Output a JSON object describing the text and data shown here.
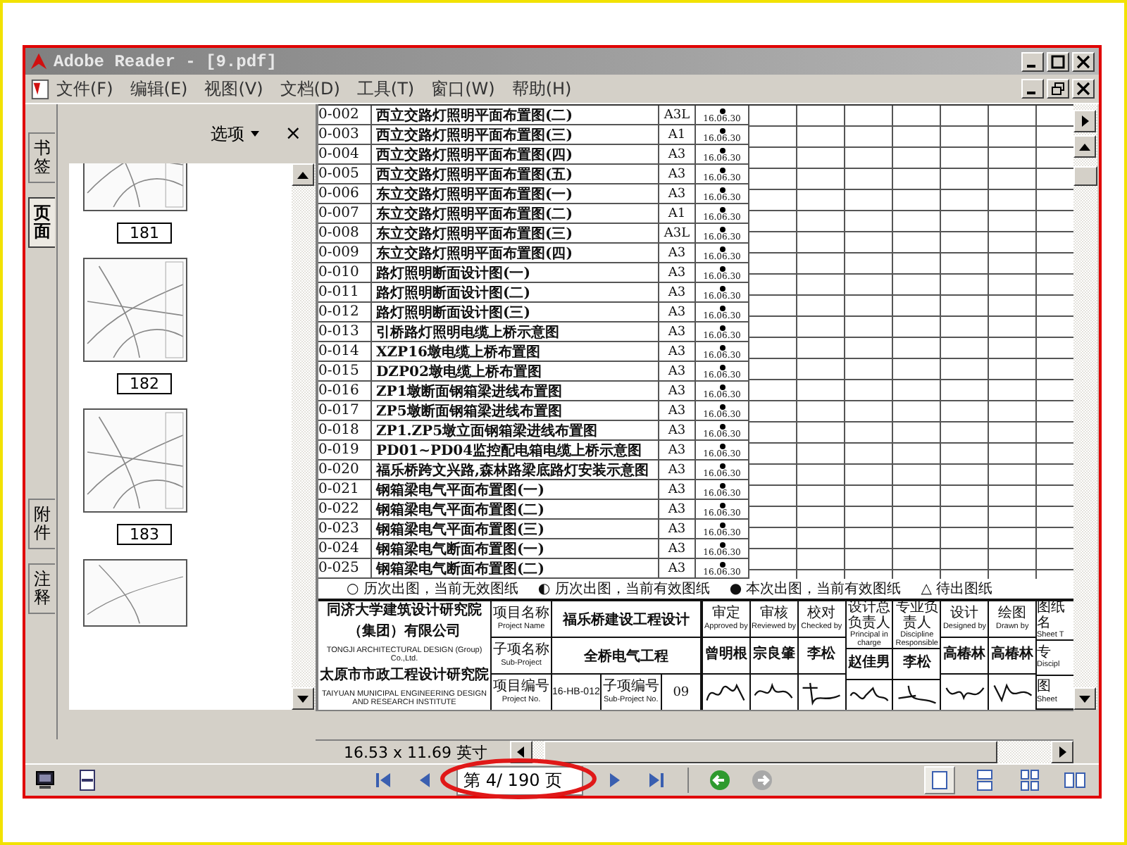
{
  "window": {
    "title": "Adobe Reader - [9.pdf]"
  },
  "menu": [
    "文件(F)",
    "编辑(E)",
    "视图(V)",
    "文档(D)",
    "工具(T)",
    "窗口(W)",
    "帮助(H)"
  ],
  "side_tabs": [
    {
      "label": "书签",
      "selected": false
    },
    {
      "label": "页面",
      "selected": true
    },
    {
      "label": "附件",
      "selected": false
    },
    {
      "label": "注释",
      "selected": false
    }
  ],
  "panel": {
    "options": "选项",
    "close": "×",
    "thumbnails": [
      "181",
      "182",
      "183"
    ]
  },
  "document": {
    "rows": [
      {
        "code": "0-002",
        "title": "西立交路灯照明平面布置图(二)",
        "size": "A3L",
        "date": "16.06.30"
      },
      {
        "code": "0-003",
        "title": "西立交路灯照明平面布置图(三)",
        "size": "A1",
        "date": "16.06.30"
      },
      {
        "code": "0-004",
        "title": "西立交路灯照明平面布置图(四)",
        "size": "A3",
        "date": "16.06.30"
      },
      {
        "code": "0-005",
        "title": "西立交路灯照明平面布置图(五)",
        "size": "A3",
        "date": "16.06.30"
      },
      {
        "code": "0-006",
        "title": "东立交路灯照明平面布置图(一)",
        "size": "A3",
        "date": "16.06.30"
      },
      {
        "code": "0-007",
        "title": "东立交路灯照明平面布置图(二)",
        "size": "A1",
        "date": "16.06.30"
      },
      {
        "code": "0-008",
        "title": "东立交路灯照明平面布置图(三)",
        "size": "A3L",
        "date": "16.06.30"
      },
      {
        "code": "0-009",
        "title": "东立交路灯照明平面布置图(四)",
        "size": "A3",
        "date": "16.06.30"
      },
      {
        "code": "0-010",
        "title": "路灯照明断面设计图(一)",
        "size": "A3",
        "date": "16.06.30"
      },
      {
        "code": "0-011",
        "title": "路灯照明断面设计图(二)",
        "size": "A3",
        "date": "16.06.30"
      },
      {
        "code": "0-012",
        "title": "路灯照明断面设计图(三)",
        "size": "A3",
        "date": "16.06.30"
      },
      {
        "code": "0-013",
        "title": "引桥路灯照明电缆上桥示意图",
        "size": "A3",
        "date": "16.06.30"
      },
      {
        "code": "0-014",
        "title": "XZP16墩电缆上桥布置图",
        "size": "A3",
        "date": "16.06.30"
      },
      {
        "code": "0-015",
        "title": "DZP02墩电缆上桥布置图",
        "size": "A3",
        "date": "16.06.30"
      },
      {
        "code": "0-016",
        "title": "ZP1墩断面钢箱梁进线布置图",
        "size": "A3",
        "date": "16.06.30"
      },
      {
        "code": "0-017",
        "title": "ZP5墩断面钢箱梁进线布置图",
        "size": "A3",
        "date": "16.06.30"
      },
      {
        "code": "0-018",
        "title": "ZP1.ZP5墩立面钢箱梁进线布置图",
        "size": "A3",
        "date": "16.06.30"
      },
      {
        "code": "0-019",
        "title": "PD01~PD04监控配电箱电缆上桥示意图",
        "size": "A3",
        "date": "16.06.30"
      },
      {
        "code": "0-020",
        "title": "福乐桥跨文兴路,森林路梁底路灯安装示意图",
        "size": "A3",
        "date": "16.06.30"
      },
      {
        "code": "0-021",
        "title": "钢箱梁电气平面布置图(一)",
        "size": "A3",
        "date": "16.06.30"
      },
      {
        "code": "0-022",
        "title": "钢箱梁电气平面布置图(二)",
        "size": "A3",
        "date": "16.06.30"
      },
      {
        "code": "0-023",
        "title": "钢箱梁电气平面布置图(三)",
        "size": "A3",
        "date": "16.06.30"
      },
      {
        "code": "0-024",
        "title": "钢箱梁电气断面布置图(一)",
        "size": "A3",
        "date": "16.06.30"
      },
      {
        "code": "0-025",
        "title": "钢箱梁电气断面布置图(二)",
        "size": "A3",
        "date": "16.06.30"
      }
    ],
    "legend": [
      {
        "symbol": "○",
        "text": "历次出图，当前无效图纸"
      },
      {
        "symbol": "◐",
        "text": "历次出图，当前有效图纸"
      },
      {
        "symbol": "●",
        "text": "本次出图，当前有效图纸"
      },
      {
        "symbol": "△",
        "text": "待出图纸"
      }
    ],
    "title_block": {
      "company": [
        "同济大学建筑设计研究院",
        "（集团）有限公司",
        "TONGJI ARCHITECTURAL DESIGN (Group) Co.,Ltd.",
        "太原市市政工程设计研究院",
        "TAIYUAN MUNICIPAL ENGINEERING DESIGN AND RESEARCH INSTITUTE"
      ],
      "fields": [
        {
          "zh": "项目名称",
          "en": "Project Name",
          "value": "福乐桥建设工程设计"
        },
        {
          "zh": "子项名称",
          "en": "Sub-Project",
          "value": "全桥电气工程"
        },
        {
          "zh": "项目编号",
          "en": "Project No.",
          "value": "16-HB-012"
        },
        {
          "zh": "子项编号",
          "en": "Sub-Project No.",
          "value": "09"
        }
      ],
      "roles": [
        {
          "zh": "审定",
          "en": "Approved by",
          "name": "曾明根"
        },
        {
          "zh": "审核",
          "en": "Reviewed by",
          "name": "宗良肇"
        },
        {
          "zh": "校对",
          "en": "Checked by",
          "name": "李松"
        },
        {
          "zh": "设计总负责人",
          "en": "Principal in charge",
          "name": "赵佳男"
        },
        {
          "zh": "专业负责人",
          "en": "Discipline Responsible",
          "name": "李松"
        },
        {
          "zh": "设计",
          "en": "Designed by",
          "name": "高椿林"
        },
        {
          "zh": "绘图",
          "en": "Drawn by",
          "name": "高椿林"
        }
      ],
      "sheet": [
        {
          "zh": "图纸名",
          "en": "Sheet T"
        },
        {
          "zh": "专",
          "en": "Discipl"
        },
        {
          "zh": "图",
          "en": "Sheet"
        }
      ]
    }
  },
  "status": {
    "page_size": "16.53 x 11.69 英寸"
  },
  "toolbar": {
    "page_field": "第 4/ 190 页",
    "view_modes": [
      {
        "kind": "single",
        "selected": true
      },
      {
        "kind": "continuous",
        "selected": false
      },
      {
        "kind": "grid",
        "selected": false
      },
      {
        "kind": "facing",
        "selected": false
      }
    ]
  }
}
